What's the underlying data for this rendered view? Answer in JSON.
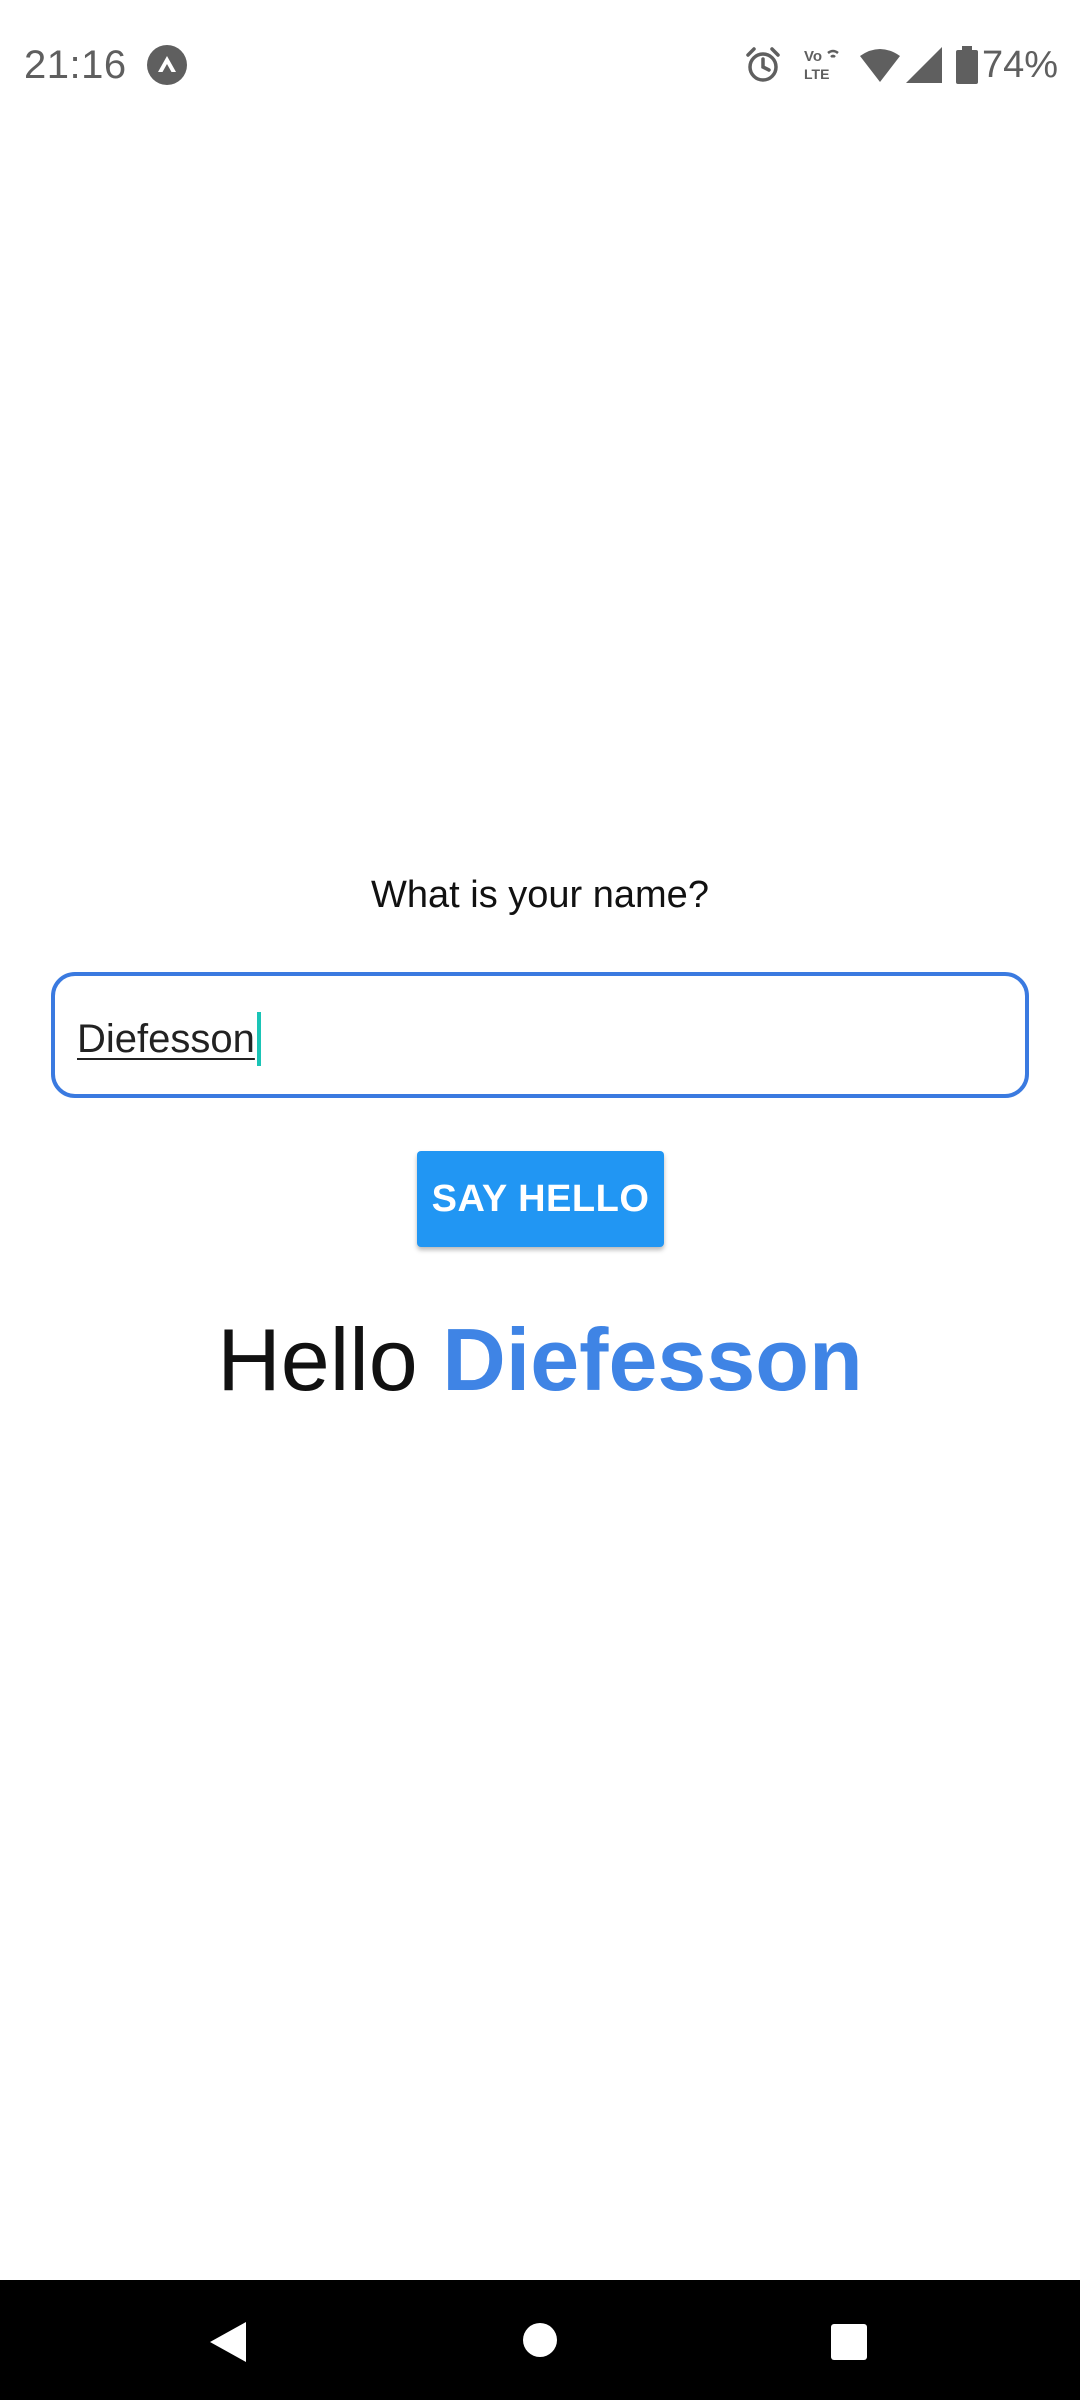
{
  "status_bar": {
    "time": "21:16",
    "battery": "74%",
    "icons": [
      "app-notification-icon",
      "alarm-icon",
      "volte-icon",
      "wifi-icon",
      "signal-icon",
      "battery-icon"
    ]
  },
  "form": {
    "question": "What is your name?",
    "name_value": "Diefesson",
    "button_label": "SAY HELLO"
  },
  "greeting": {
    "prefix": "Hello",
    "name": "Diefesson"
  },
  "colors": {
    "accent_blue": "#2196f3",
    "field_border": "#3a7ae0",
    "greeting_name": "#3f84e5",
    "cursor": "#1ac4b6"
  },
  "nav_bar": {
    "icons": [
      "back-icon",
      "home-icon",
      "recents-icon"
    ]
  }
}
